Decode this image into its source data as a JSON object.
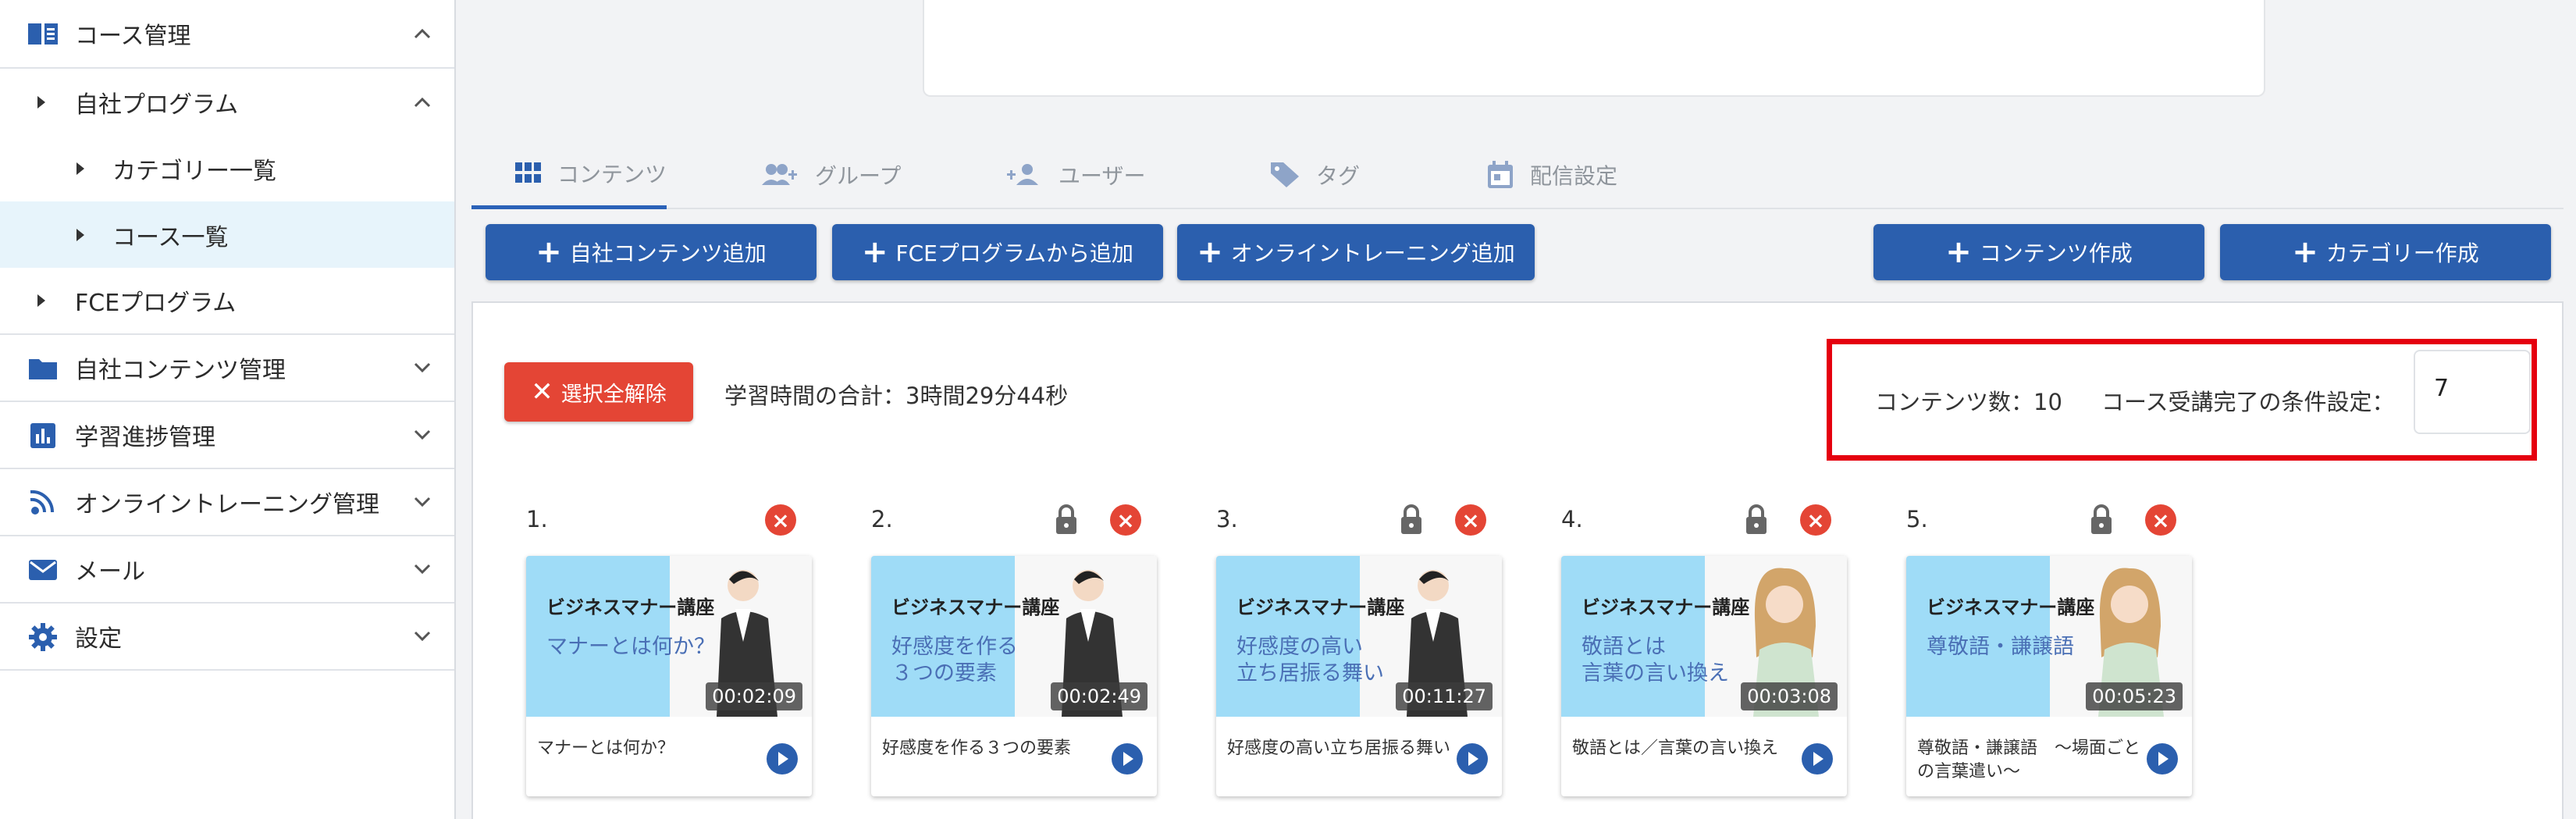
{
  "sidebar": {
    "course_mgmt": "コース管理",
    "own_program": "自社プログラム",
    "category_list": "カテゴリー一覧",
    "course_list": "コース一覧",
    "fce_program": "FCEプログラム",
    "own_content_mgmt": "自社コンテンツ管理",
    "progress_mgmt": "学習進捗管理",
    "online_training_mgmt": "オンライントレーニング管理",
    "mail": "メール",
    "settings": "設定"
  },
  "tabs": {
    "contents": "コンテンツ",
    "groups": "グループ",
    "users": "ユーザー",
    "tags": "タグ",
    "delivery": "配信設定"
  },
  "buttons": {
    "add_own_content": "自社コンテンツ追加",
    "add_from_fce": "FCEプログラムから追加",
    "add_online_training": "オンライントレーニング追加",
    "create_content": "コンテンツ作成",
    "create_category": "カテゴリー作成",
    "clear_selection": "選択全解除"
  },
  "summary": {
    "study_time": "学習時間の合計：3時間29分44秒",
    "content_count": "コンテンツ数：10",
    "completion_condition_label": "コース受講完了の条件設定：",
    "completion_condition_value": "7"
  },
  "cards": [
    {
      "num": "1.",
      "brand": "ビジネスマナー講座",
      "subtitle": "マナーとは何か？",
      "duration": "00:02:09",
      "title": "マナーとは何か？",
      "locked": false
    },
    {
      "num": "2.",
      "brand": "ビジネスマナー講座",
      "subtitle": "好感度を作る\n３つの要素",
      "duration": "00:02:49",
      "title": "好感度を作る３つの要素",
      "locked": true
    },
    {
      "num": "3.",
      "brand": "ビジネスマナー講座",
      "subtitle": "好感度の高い\n立ち居振る舞い",
      "duration": "00:11:27",
      "title": "好感度の高い立ち居振る舞い",
      "locked": true
    },
    {
      "num": "4.",
      "brand": "ビジネスマナー講座",
      "subtitle": "敬語とは\n言葉の言い換え",
      "duration": "00:03:08",
      "title": "敬語とは／言葉の言い換え",
      "locked": true
    },
    {
      "num": "5.",
      "brand": "ビジネスマナー講座",
      "subtitle": "尊敬語・謙譲語",
      "duration": "00:05:23",
      "title": "尊敬語・謙譲語　〜場面ごとの言葉遣い〜",
      "locked": true
    }
  ],
  "colors": {
    "primary": "#2b5fae",
    "danger": "#e44535",
    "highlight": "#e5000f",
    "thumb_blue": "#9fdcf7"
  }
}
